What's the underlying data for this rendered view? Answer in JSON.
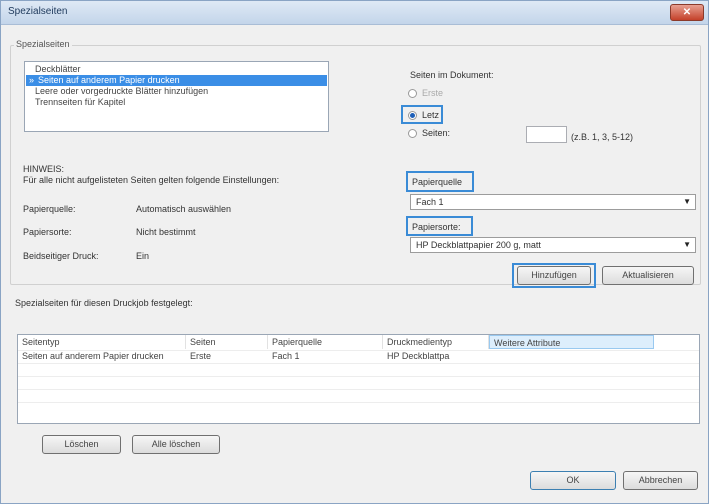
{
  "window": {
    "title": "Spezialseiten",
    "close_label": "✕"
  },
  "pages_group": {
    "label": "Spezialseiten"
  },
  "special_list": [
    {
      "label": "Deckblätter"
    },
    {
      "label": "Seiten auf anderem Papier drucken",
      "marker": "»"
    },
    {
      "label": "Leere oder vorgedruckte Blätter hinzufügen"
    },
    {
      "label": "Trennseiten für Kapitel"
    }
  ],
  "pages_in_doc": {
    "label": "Seiten im Dokument:",
    "options": [
      "Erste",
      "Letz",
      "Seiten:"
    ],
    "pages_input": {
      "value": "",
      "hint": "(z.B. 1, 3, 5-12)"
    }
  },
  "note": {
    "title": "HINWEIS:",
    "text": "Für alle nicht aufgelisteten Seiten gelten folgende Einstellungen:",
    "rows": [
      {
        "label": "Papierquelle:",
        "value": "Automatisch auswählen"
      },
      {
        "label": "Papiersorte:",
        "value": "Nicht bestimmt"
      },
      {
        "label": "Beidseitiger Druck:",
        "value": "Ein"
      }
    ]
  },
  "source": {
    "label": "Papierquelle",
    "value": "Fach 1"
  },
  "type": {
    "label": "Papiersorte:",
    "value": "HP Deckblattpapier 200 g, matt"
  },
  "buttons": {
    "add": "Hinzufügen",
    "refresh": "Aktualisieren",
    "delete": "Löschen",
    "delete_all": "Alle löschen",
    "ok": "OK",
    "cancel": "Abbrechen"
  },
  "table": {
    "caption": "Spezialseiten für diesen Druckjob festgelegt:",
    "headers": [
      "Seitentyp",
      "Seiten",
      "Papierquelle",
      "Druckmedientyp",
      "Weitere Attribute"
    ],
    "rows": [
      [
        "Seiten auf anderem Papier drucken",
        "Erste",
        "Fach 1",
        "HP Deckblattpa",
        ""
      ]
    ]
  }
}
